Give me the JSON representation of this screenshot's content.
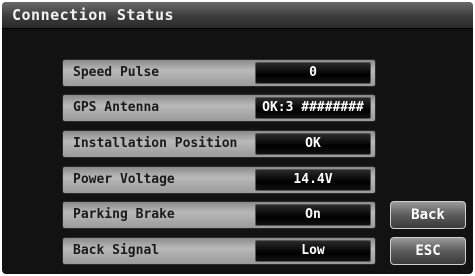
{
  "screen": {
    "title": "Connection Status"
  },
  "rows": [
    {
      "label": "Speed Pulse",
      "value": "0"
    },
    {
      "label": "GPS Antenna",
      "value": "OK:3 ########"
    },
    {
      "label": "Installation Position",
      "value": "OK"
    },
    {
      "label": "Power Voltage",
      "value": "14.4V"
    },
    {
      "label": "Parking Brake",
      "value": "On"
    },
    {
      "label": "Back Signal",
      "value": "Low"
    }
  ],
  "buttons": {
    "back": "Back",
    "esc": "ESC"
  }
}
